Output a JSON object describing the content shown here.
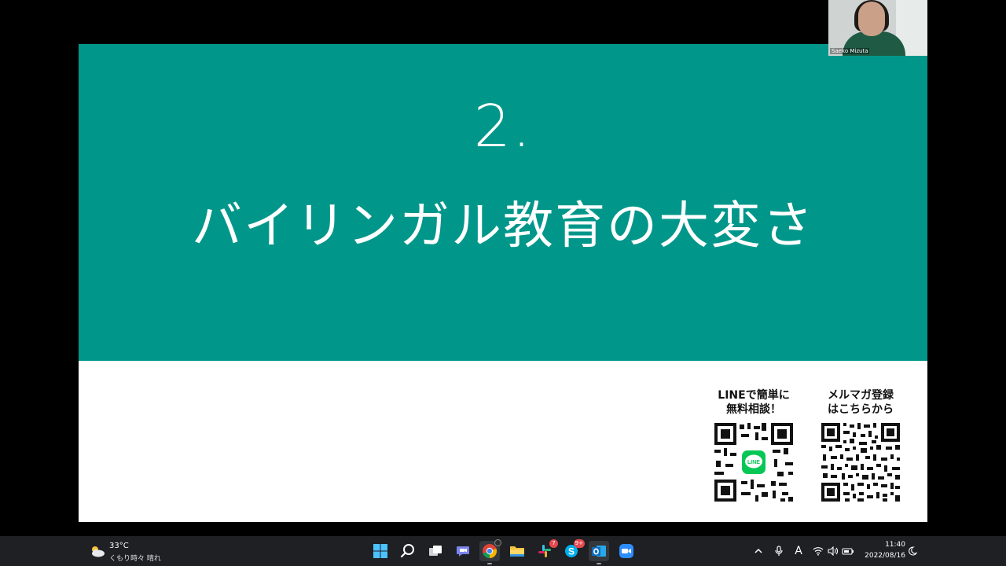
{
  "slide": {
    "number": "2.",
    "title": "バイリンガル教育の大変さ",
    "qr_line": {
      "caption_line1": "LINEで簡単に",
      "caption_line2": "無料相談！",
      "logo_text": "LINE"
    },
    "qr_mailmag": {
      "caption_line1": "メルマガ登録",
      "caption_line2": "はこちらから"
    },
    "colors": {
      "header_bg": "#00978a",
      "body_bg": "#ffffff",
      "line_green": "#06c755"
    }
  },
  "video": {
    "participant_name": "Saeko Mizuta"
  },
  "taskbar": {
    "weather": {
      "temperature": "33°C",
      "description": "くもり時々 晴れ",
      "icon": "cloud-sun-icon"
    },
    "apps": [
      {
        "name": "start-icon"
      },
      {
        "name": "search-icon"
      },
      {
        "name": "task-view-icon"
      },
      {
        "name": "teams-chat-icon"
      },
      {
        "name": "chrome-icon",
        "active": true
      },
      {
        "name": "file-explorer-icon"
      },
      {
        "name": "slack-icon",
        "badge": "7"
      },
      {
        "name": "skype-icon",
        "badge": "9+"
      },
      {
        "name": "outlook-icon",
        "active": true
      },
      {
        "name": "zoom-icon"
      }
    ],
    "tray": {
      "icons": [
        "chevron-up-icon",
        "microphone-icon",
        "ime-icon",
        "wifi-icon",
        "speaker-icon",
        "battery-icon",
        "notification-icon"
      ],
      "ime_label": "A",
      "time": "11:40",
      "date": "2022/08/16"
    }
  }
}
